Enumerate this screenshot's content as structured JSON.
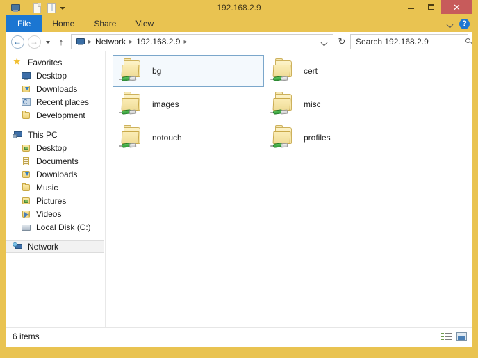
{
  "window": {
    "title": "192.168.2.9",
    "quick_access": [
      {
        "name": "explorer-icon",
        "glyph": "explorer"
      },
      {
        "name": "new-folder-icon",
        "glyph": "page"
      },
      {
        "name": "properties-icon",
        "glyph": "props"
      }
    ],
    "controls": {
      "minimize": "–",
      "maximize": "□",
      "close": "✕"
    },
    "frame_color": "#e9c351",
    "close_color": "#c75b5b"
  },
  "ribbon": {
    "file_label": "File",
    "tabs": [
      "Home",
      "Share",
      "View"
    ],
    "expand_label": "˅",
    "help_label": "?"
  },
  "address": {
    "back_glyph": "←",
    "forward_glyph": "→",
    "recent_glyph": "▾",
    "up_glyph": "↑",
    "crumbs": [
      "Network",
      "192.168.2.9"
    ],
    "separator": "▸",
    "refresh_glyph": "↻"
  },
  "search": {
    "placeholder": "Search 192.168.2.9",
    "value": ""
  },
  "sidebar": {
    "groups": [
      {
        "header": {
          "label": "Favorites",
          "icon": "star-icon"
        },
        "items": [
          {
            "label": "Desktop",
            "icon": "monitor-icon"
          },
          {
            "label": "Downloads",
            "icon": "downloads-folder-icon"
          },
          {
            "label": "Recent places",
            "icon": "recent-places-icon"
          },
          {
            "label": "Development",
            "icon": "folder-icon"
          }
        ]
      },
      {
        "header": {
          "label": "This PC",
          "icon": "computer-icon"
        },
        "items": [
          {
            "label": "Desktop",
            "icon": "desktop-folder-icon"
          },
          {
            "label": "Documents",
            "icon": "documents-folder-icon"
          },
          {
            "label": "Downloads",
            "icon": "downloads-folder-icon"
          },
          {
            "label": "Music",
            "icon": "music-folder-icon"
          },
          {
            "label": "Pictures",
            "icon": "pictures-folder-icon"
          },
          {
            "label": "Videos",
            "icon": "videos-folder-icon"
          },
          {
            "label": "Local Disk (C:)",
            "icon": "hard-disk-icon"
          }
        ]
      },
      {
        "header": {
          "label": "Network",
          "icon": "network-icon",
          "selected": true
        },
        "items": []
      }
    ]
  },
  "content": {
    "items": [
      {
        "label": "bg",
        "icon": "shared-folder-icon",
        "selected": true
      },
      {
        "label": "images",
        "icon": "shared-folder-icon",
        "selected": false
      },
      {
        "label": "notouch",
        "icon": "shared-folder-icon",
        "selected": false
      },
      {
        "label": "cert",
        "icon": "shared-folder-icon",
        "selected": false
      },
      {
        "label": "misc",
        "icon": "shared-folder-icon",
        "selected": false
      },
      {
        "label": "profiles",
        "icon": "shared-folder-icon",
        "selected": false
      }
    ]
  },
  "status": {
    "items_text": "6 items",
    "view_details_label": "Details view",
    "view_icons_label": "Large icons view"
  }
}
